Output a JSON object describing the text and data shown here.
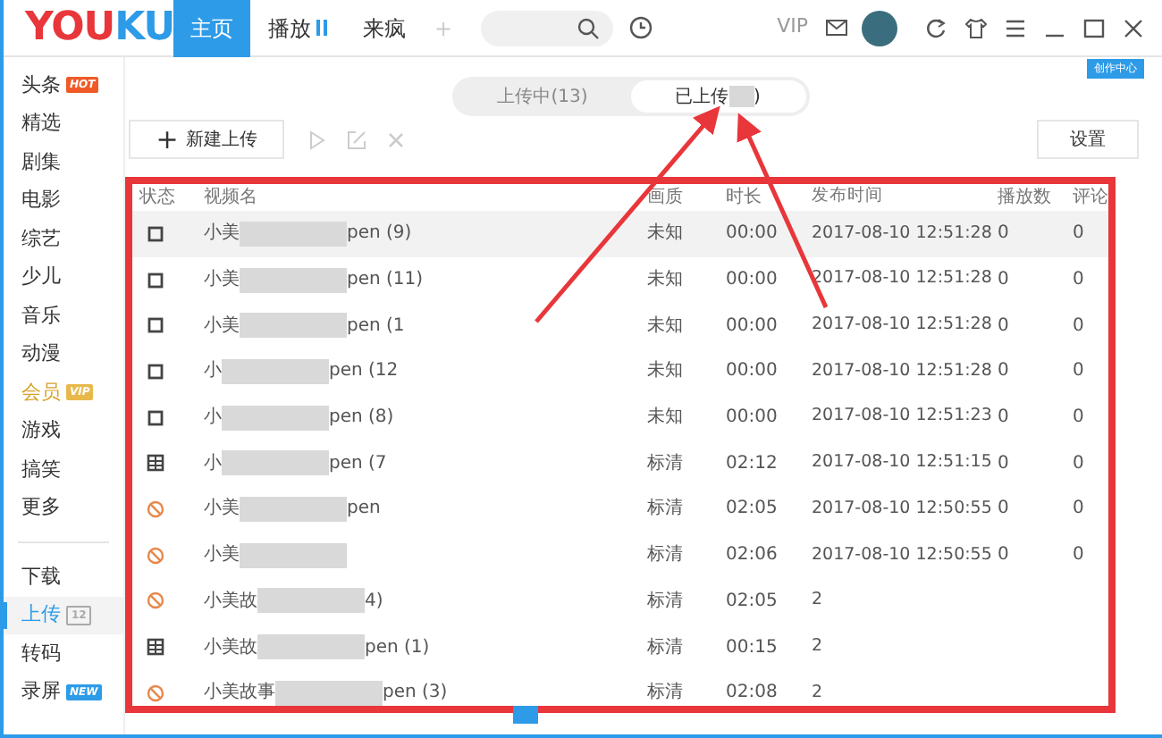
{
  "logo": {
    "left": "YOU",
    "right": "KU"
  },
  "top_tabs": [
    {
      "label": "主页",
      "selected": true,
      "kind": "plain"
    },
    {
      "label": "播放",
      "selected": false,
      "kind": "pause"
    },
    {
      "label": "来疯",
      "selected": false,
      "kind": "plain"
    }
  ],
  "add_tab": "+",
  "vip": "VIP",
  "creator_center": "创作中心",
  "sidebar": {
    "groups": [
      [
        {
          "label": "头条",
          "badge": "HOT",
          "selected": false,
          "kind": "hot"
        },
        {
          "label": "精选",
          "selected": false,
          "kind": "plain"
        },
        {
          "label": "剧集",
          "selected": false,
          "kind": "plain"
        },
        {
          "label": "电影",
          "selected": false,
          "kind": "plain"
        },
        {
          "label": "综艺",
          "selected": false,
          "kind": "plain"
        },
        {
          "label": "少儿",
          "selected": false,
          "kind": "plain"
        },
        {
          "label": "音乐",
          "selected": false,
          "kind": "plain"
        },
        {
          "label": "动漫",
          "selected": false,
          "kind": "plain"
        },
        {
          "label": "会员",
          "badge": "VIP",
          "selected": false,
          "kind": "gold"
        },
        {
          "label": "游戏",
          "selected": false,
          "kind": "plain"
        },
        {
          "label": "搞笑",
          "selected": false,
          "kind": "plain"
        },
        {
          "label": "更多",
          "selected": false,
          "kind": "plain"
        }
      ],
      [
        {
          "label": "下载",
          "selected": false,
          "kind": "plain"
        },
        {
          "label": "上传",
          "badge": "12",
          "selected": true,
          "kind": "count"
        },
        {
          "label": "转码",
          "selected": false,
          "kind": "plain"
        },
        {
          "label": "录屏",
          "badge": "NEW",
          "selected": false,
          "kind": "new"
        }
      ]
    ]
  },
  "segments": [
    {
      "label": "上传中(13)",
      "blurred": false,
      "selected": false
    },
    {
      "label": "已上传",
      "suffix": ")",
      "blurred": true,
      "selected": true
    }
  ],
  "new_upload": {
    "icon": "+",
    "label": "新建上传"
  },
  "settings": "设置",
  "table": {
    "columns": [
      "状态",
      "视频名",
      "画质",
      "时长",
      "发布时间",
      "播放数",
      "评论"
    ],
    "rows": [
      {
        "kind": "pending",
        "name_start": "小美",
        "name_end": "pen (9)",
        "quality": "未知",
        "duration": "00:00",
        "published": "2017-08-10 12:51:28",
        "plays": "0",
        "comments": "0",
        "selected": true
      },
      {
        "kind": "pending",
        "name_start": "小美",
        "name_end": "pen (11)",
        "quality": "未知",
        "duration": "00:00",
        "published": "2017-08-10 12:51:28",
        "plays": "0",
        "comments": "0",
        "selected": false
      },
      {
        "kind": "pending",
        "name_start": "小美",
        "name_end": "pen (1",
        "quality": "未知",
        "duration": "00:00",
        "published": "2017-08-10 12:51:28",
        "plays": "0",
        "comments": "0",
        "selected": false
      },
      {
        "kind": "pending",
        "name_start": "小",
        "name_end": "pen (12",
        "quality": "未知",
        "duration": "00:00",
        "published": "2017-08-10 12:51:28",
        "plays": "0",
        "comments": "0",
        "selected": false
      },
      {
        "kind": "pending",
        "name_start": "小",
        "name_end": "pen (8)",
        "quality": "未知",
        "duration": "00:00",
        "published": "2017-08-10 12:51:23",
        "plays": "0",
        "comments": "0",
        "selected": false
      },
      {
        "kind": "published",
        "name_start": "小",
        "name_end": "pen (7",
        "quality": "标清",
        "duration": "02:12",
        "published": "2017-08-10 12:51:15",
        "plays": "0",
        "comments": "0",
        "selected": false
      },
      {
        "kind": "blocked",
        "name_start": "小美",
        "name_end": "pen",
        "quality": "标清",
        "duration": "02:05",
        "published": "2017-08-10 12:50:55",
        "plays": "0",
        "comments": "0",
        "selected": false
      },
      {
        "kind": "blocked",
        "name_start": "小美",
        "quality": "标清",
        "duration": "02:06",
        "published": "2017-08-10 12:50:55",
        "plays": "0",
        "comments": "0",
        "selected": false
      },
      {
        "kind": "blocked",
        "name_start": "小美故",
        "name_end": "4)",
        "quality": "标清",
        "duration": "02:05",
        "published": "2",
        "selected": false
      },
      {
        "kind": "published",
        "name_start": "小美故",
        "name_end": "pen (1)",
        "quality": "标清",
        "duration": "00:15",
        "published": "2",
        "selected": false
      },
      {
        "kind": "blocked",
        "name_start": "小美故事",
        "name_end": "pen (3)",
        "quality": "标清",
        "duration": "02:08",
        "published": "2",
        "selected": false
      }
    ]
  }
}
